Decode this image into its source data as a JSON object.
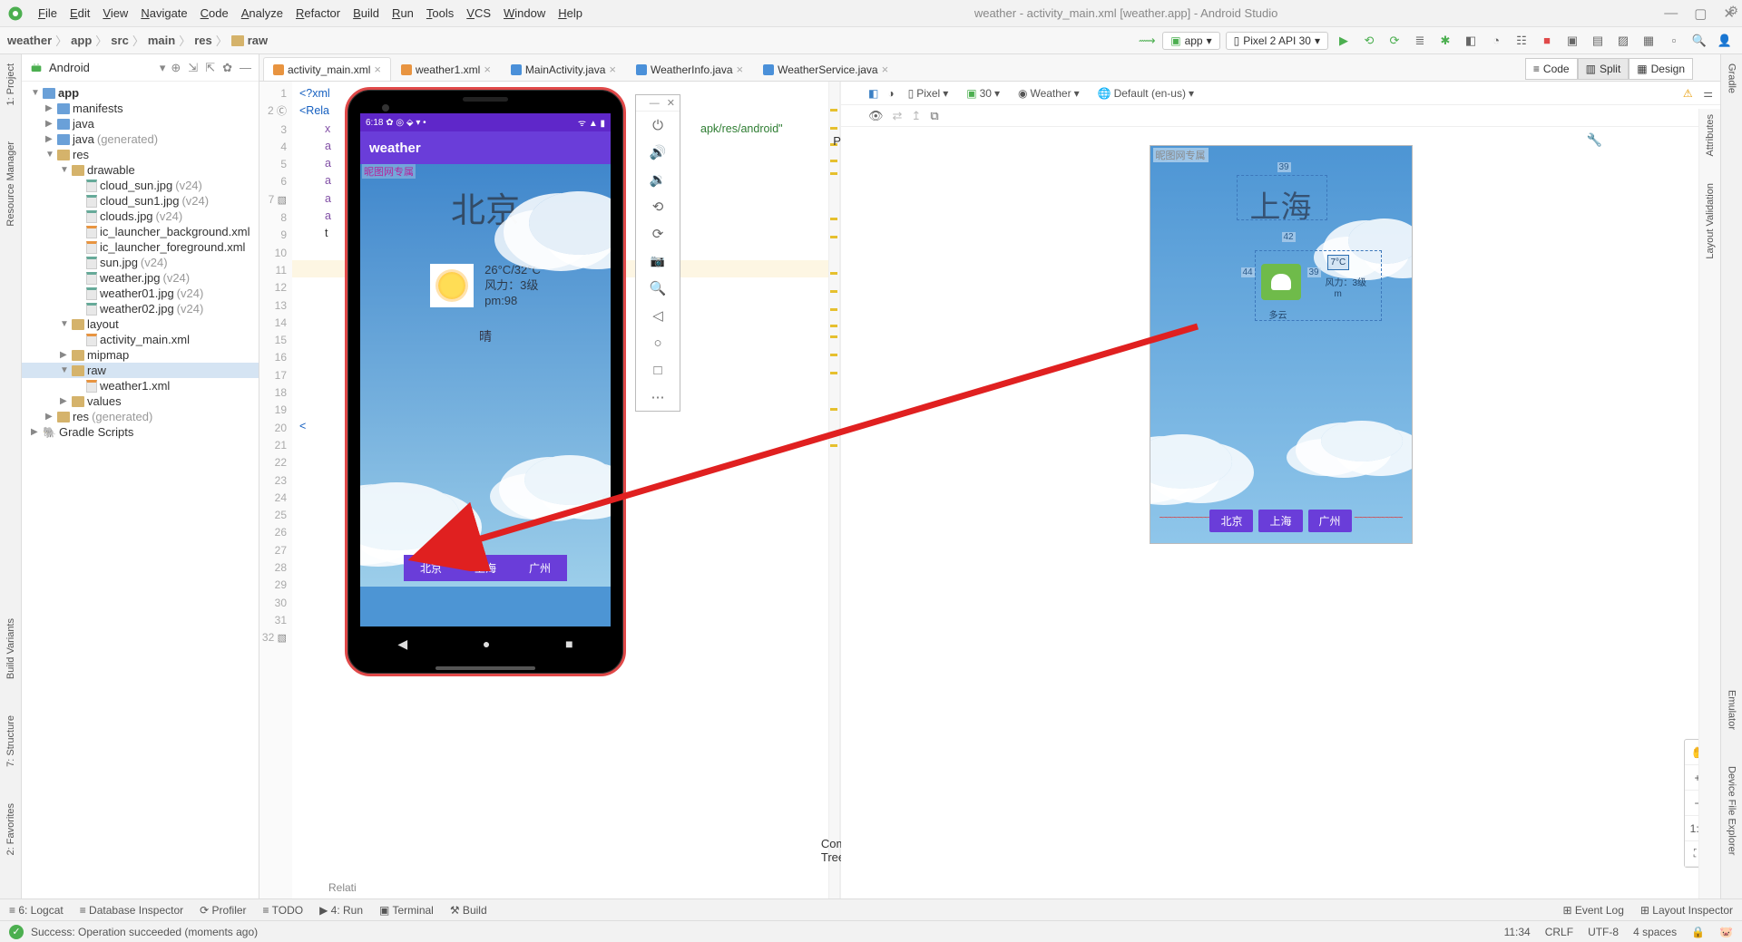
{
  "window": {
    "title": "weather - activity_main.xml [weather.app] - Android Studio"
  },
  "menus": [
    "File",
    "Edit",
    "View",
    "Navigate",
    "Code",
    "Analyze",
    "Refactor",
    "Build",
    "Run",
    "Tools",
    "VCS",
    "Window",
    "Help"
  ],
  "breadcrumb": [
    "weather",
    "app",
    "src",
    "main",
    "res",
    "raw"
  ],
  "run_config": "app",
  "device_select": "Pixel 2 API 30",
  "project_panel_title": "Android",
  "modes": {
    "code": "Code",
    "split": "Split",
    "design": "Design"
  },
  "tree": [
    {
      "d": 0,
      "a": "▼",
      "ic": "mod",
      "label": "app",
      "bold": true
    },
    {
      "d": 1,
      "a": "▶",
      "ic": "fb",
      "label": "manifests"
    },
    {
      "d": 1,
      "a": "▶",
      "ic": "fb",
      "label": "java"
    },
    {
      "d": 1,
      "a": "▶",
      "ic": "fb",
      "label": "java",
      "suffix": "(generated)"
    },
    {
      "d": 1,
      "a": "▼",
      "ic": "ft",
      "label": "res"
    },
    {
      "d": 2,
      "a": "▼",
      "ic": "ft",
      "label": "drawable"
    },
    {
      "d": 3,
      "a": "",
      "ic": "img",
      "label": "cloud_sun.jpg",
      "suffix": "(v24)"
    },
    {
      "d": 3,
      "a": "",
      "ic": "img",
      "label": "cloud_sun1.jpg",
      "suffix": "(v24)"
    },
    {
      "d": 3,
      "a": "",
      "ic": "img",
      "label": "clouds.jpg",
      "suffix": "(v24)"
    },
    {
      "d": 3,
      "a": "",
      "ic": "xml",
      "label": "ic_launcher_background.xml"
    },
    {
      "d": 3,
      "a": "",
      "ic": "xml",
      "label": "ic_launcher_foreground.xml"
    },
    {
      "d": 3,
      "a": "",
      "ic": "img",
      "label": "sun.jpg",
      "suffix": "(v24)"
    },
    {
      "d": 3,
      "a": "",
      "ic": "img",
      "label": "weather.jpg",
      "suffix": "(v24)"
    },
    {
      "d": 3,
      "a": "",
      "ic": "img",
      "label": "weather01.jpg",
      "suffix": "(v24)"
    },
    {
      "d": 3,
      "a": "",
      "ic": "img",
      "label": "weather02.jpg",
      "suffix": "(v24)"
    },
    {
      "d": 2,
      "a": "▼",
      "ic": "ft",
      "label": "layout"
    },
    {
      "d": 3,
      "a": "",
      "ic": "xml",
      "label": "activity_main.xml"
    },
    {
      "d": 2,
      "a": "▶",
      "ic": "ft",
      "label": "mipmap"
    },
    {
      "d": 2,
      "a": "▼",
      "ic": "ft",
      "label": "raw",
      "sel": true
    },
    {
      "d": 3,
      "a": "",
      "ic": "xml",
      "label": "weather1.xml"
    },
    {
      "d": 2,
      "a": "▶",
      "ic": "ft",
      "label": "values"
    },
    {
      "d": 1,
      "a": "▶",
      "ic": "ft",
      "label": "res",
      "suffix": "(generated)"
    },
    {
      "d": 0,
      "a": "▶",
      "ic": "gr",
      "label": "Gradle Scripts"
    }
  ],
  "tabs": [
    {
      "label": "activity_main.xml",
      "type": "xml",
      "active": true
    },
    {
      "label": "weather1.xml",
      "type": "xml"
    },
    {
      "label": "MainActivity.java",
      "type": "java"
    },
    {
      "label": "WeatherInfo.java",
      "type": "java"
    },
    {
      "label": "WeatherService.java",
      "type": "java"
    }
  ],
  "code": {
    "xml_decl": "<?xml",
    "root_open": "<Rela",
    "ns_value": "apk/res/android\"",
    "attr_prefix": "a",
    "text_prefix": "t",
    "x_line": "x",
    "bottom_label": "Relati"
  },
  "design_toolbar": {
    "device": "Pixel",
    "api": "30",
    "theme": "Weather",
    "locale": "Default (en-us)"
  },
  "blueprint": {
    "watermark": "昵图网专属",
    "city": "上海",
    "dim_top": "39",
    "dim_mid": "42",
    "dim_left": "44",
    "dim_right": "39",
    "temp": "7°C",
    "wind": "风力：3级",
    "pm": "m",
    "cond": "多云",
    "buttons": [
      "北京",
      "上海",
      "广州"
    ]
  },
  "phone": {
    "time": "6:18",
    "status_icons": "✿ ◎ ⬙ ▾ •",
    "signal": "ᯤ ▲ ▮",
    "app_title": "weather",
    "watermark": "昵图网专属",
    "city": "北京",
    "temp": "26°C/32°C",
    "wind": "风力：3级",
    "pm": "pm:98",
    "cond": "晴",
    "buttons": [
      "北京",
      "上海",
      "广州"
    ]
  },
  "left_tools": [
    "1: Project",
    "Resource Manager"
  ],
  "left_tools_bottom": [
    "2: Favorites",
    "7: Structure",
    "Build Variants"
  ],
  "right_tools": [
    "Gradle",
    "Attributes",
    "Layout Validation"
  ],
  "right_tools_lower": [
    "Emulator",
    "Device File Explorer"
  ],
  "design_inner_left": [
    "Palette"
  ],
  "design_inner_left_bottom": [
    "Component Tree"
  ],
  "bottom": {
    "items": [
      "≡ 6: Logcat",
      "≡ Database Inspector",
      "⟳ Profiler",
      "≡ TODO",
      "▶ 4: Run",
      "▣ Terminal",
      "⚒ Build"
    ],
    "right": [
      "Event Log",
      "Layout Inspector"
    ]
  },
  "status": {
    "message": "Success: Operation succeeded (moments ago)",
    "right": [
      "11:34",
      "CRLF",
      "UTF-8",
      "4 spaces"
    ]
  }
}
